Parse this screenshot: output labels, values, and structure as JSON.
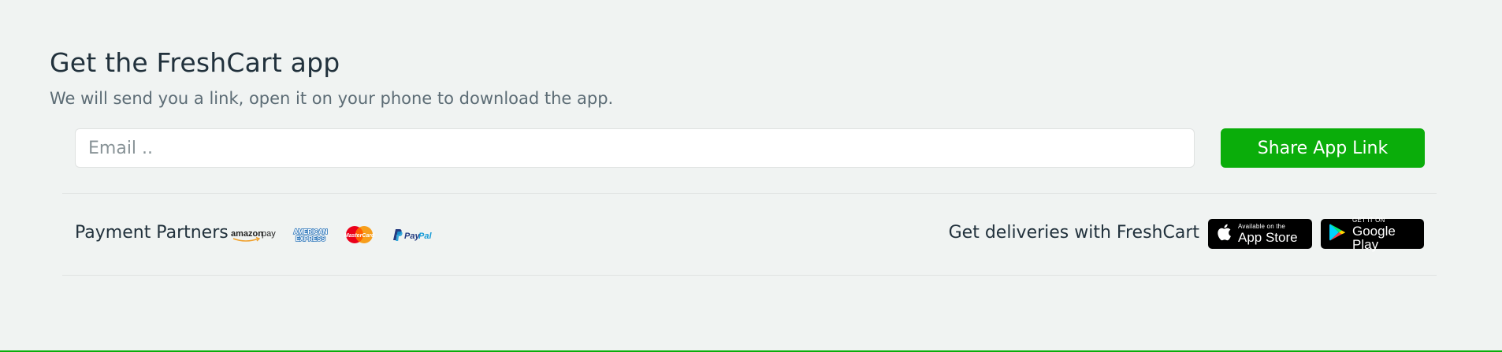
{
  "app_section": {
    "title": "Get the FreshCart app",
    "subtitle": "We will send you a link, open it on your phone to download the app.",
    "email_placeholder": "Email ..",
    "email_value": "",
    "share_button_label": "Share App Link"
  },
  "footer_bar": {
    "partners_label": "Payment Partners",
    "partner_logos": [
      "amazon-pay-logo",
      "american-express-logo",
      "mastercard-logo",
      "paypal-logo"
    ],
    "deliveries_label": "Get deliveries with FreshCart",
    "app_store": {
      "small": "Available on the",
      "big": "App Store"
    },
    "google_play": {
      "small": "GET IT ON",
      "big": "Google Play"
    }
  },
  "colors": {
    "background": "#f0f3f2",
    "accent": "#0aad0a",
    "text": "#21313c",
    "muted_text": "#5c6c75"
  }
}
